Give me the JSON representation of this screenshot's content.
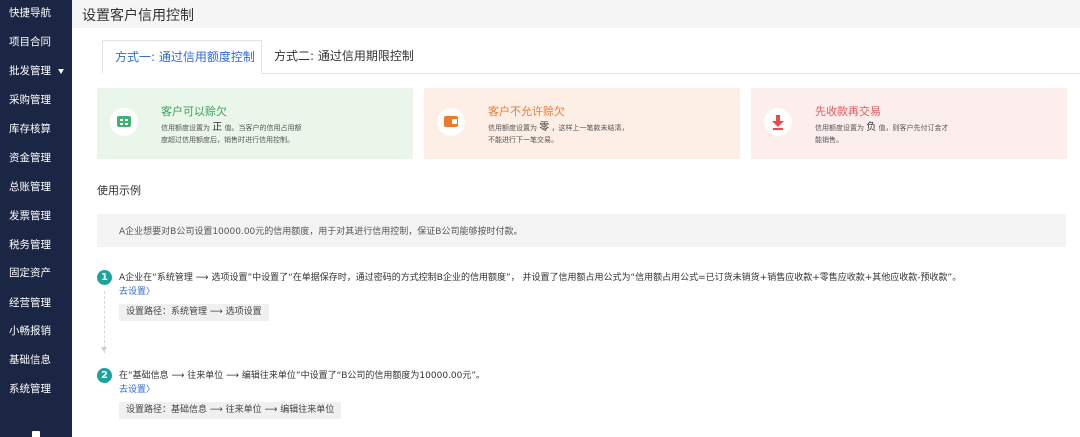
{
  "sidebar": {
    "items": [
      {
        "label": "快捷导航"
      },
      {
        "label": "项目合同"
      },
      {
        "label": "批发管理"
      },
      {
        "label": "采购管理"
      },
      {
        "label": "库存核算"
      },
      {
        "label": "资金管理"
      },
      {
        "label": "总账管理"
      },
      {
        "label": "发票管理"
      },
      {
        "label": "税务管理"
      },
      {
        "label": "固定资产"
      },
      {
        "label": "经营管理"
      },
      {
        "label": "小畅报销"
      },
      {
        "label": "基础信息"
      },
      {
        "label": "系统管理"
      }
    ]
  },
  "header": {
    "title": "设置客户信用控制"
  },
  "tabs": [
    {
      "label": "方式一: 通过信用额度控制",
      "active": true
    },
    {
      "label": "方式二: 通过信用期限控制",
      "active": false
    }
  ],
  "cards": [
    {
      "title": "客户可以赊欠",
      "desc_prefix": "信用额度设置为",
      "highlight": "正",
      "desc_suffix": "值。当客户的信用占用额",
      "desc_line2": "度超过信用额度后，销售时进行信用控制。",
      "icon": "wallet-icon",
      "color": "#3cb371"
    },
    {
      "title": "客户不允许赊欠",
      "desc_prefix": "信用额度设置为",
      "highlight": "零",
      "desc_suffix": "，这样上一笔款未结清，",
      "desc_line2": "不能进行下一笔交易。",
      "icon": "purse-icon",
      "color": "#f07a2a"
    },
    {
      "title": "先收款再交易",
      "desc_prefix": "信用额度设置为",
      "highlight": "负",
      "desc_suffix": "值，则客户先付订金才",
      "desc_line2": "能销售。",
      "icon": "download-icon",
      "color": "#e94b4b"
    }
  ],
  "usage": {
    "title": "使用示例",
    "intro": "A企业想要对B公司设置10000.00元的信用额度，用于对其进行信用控制，保证B公司能够按时付款。",
    "steps": [
      {
        "number": "1",
        "text": "A企业在“系统管理 ⟶ 选项设置”中设置了“在单据保存时，通过密码的方式控制B企业的信用额度”， 并设置了信用额占用公式为“信用额占用公式=已订货未销货+销售应收款+零售应收款+其他应收款-预收款”。",
        "link": "去设置〉",
        "path": "设置路径：系统管理 ⟶ 选项设置"
      },
      {
        "number": "2",
        "text": "在“基础信息 ⟶ 往来单位 ⟶ 编辑往来单位”中设置了“B公司的信用额度为10000.00元”。",
        "link": "去设置〉",
        "path": "设置路径：基础信息 ⟶ 往来单位 ⟶ 编辑往来单位"
      }
    ]
  }
}
